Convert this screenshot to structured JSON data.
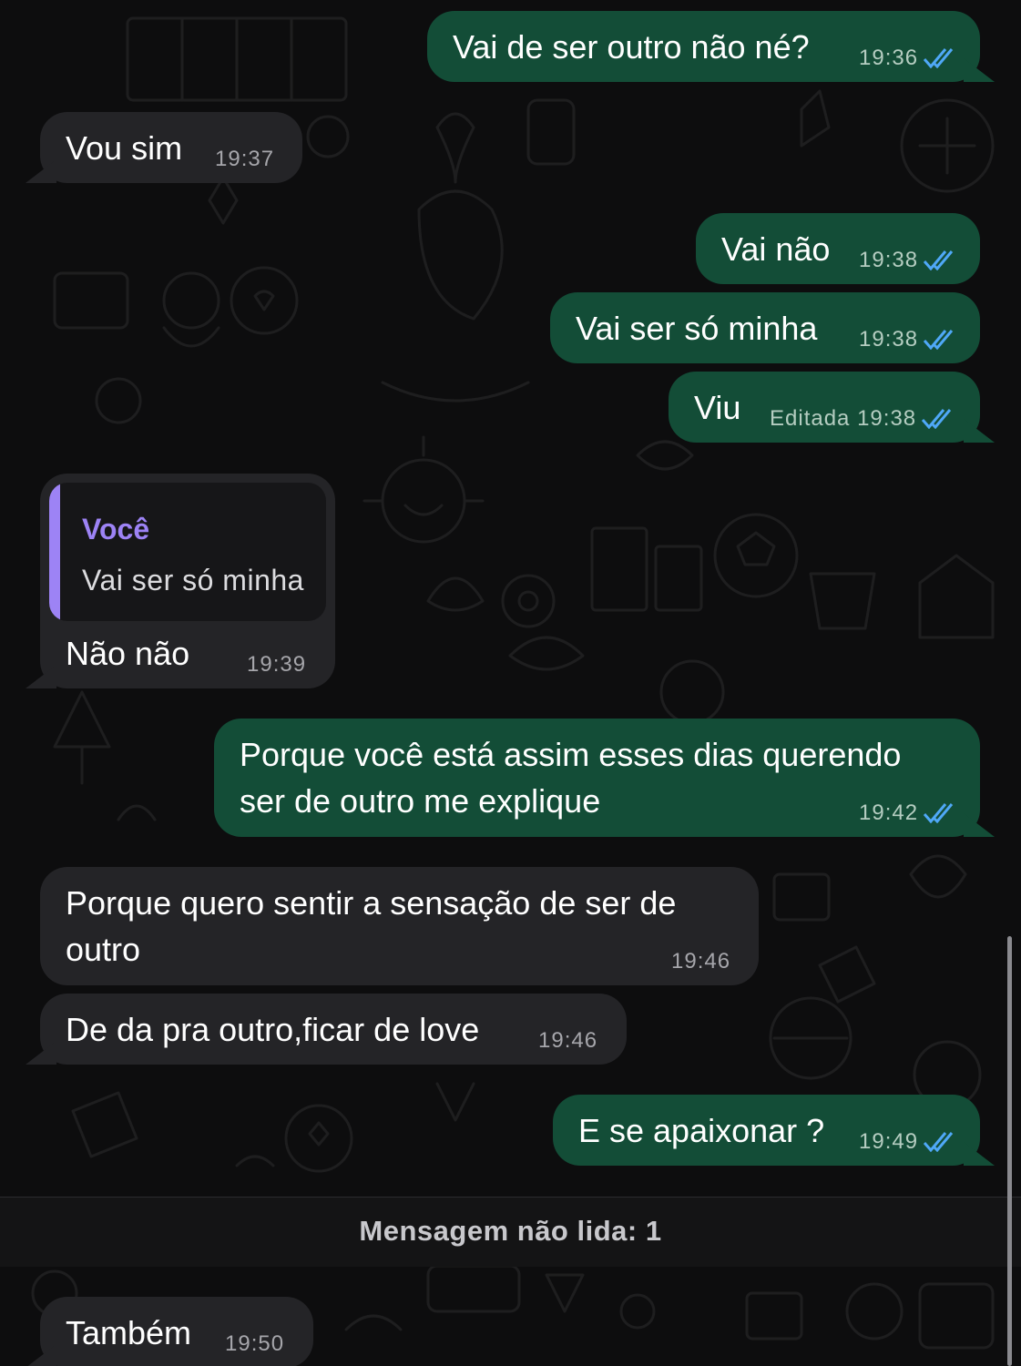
{
  "colors": {
    "outgoing_bubble": "#134d37",
    "incoming_bubble": "#242427",
    "read_ticks": "#4fa8f7",
    "quote_accent": "#9d83f5",
    "background": "#0d0d0e"
  },
  "messages": [
    {
      "direction": "out",
      "text": "Vai de ser outro não né?",
      "time": "19:36",
      "status": "read-double-check-icon"
    },
    {
      "direction": "in",
      "text": "Vou sim",
      "time": "19:37"
    },
    {
      "direction": "out",
      "text": "Vai não",
      "time": "19:38",
      "status": "read-double-check-icon"
    },
    {
      "direction": "out",
      "text": "Vai ser só minha",
      "time": "19:38",
      "status": "read-double-check-icon"
    },
    {
      "direction": "out",
      "text": "Viu",
      "edited_label": "Editada",
      "time": "19:38",
      "status": "read-double-check-icon"
    },
    {
      "direction": "in",
      "reply_to": {
        "author": "Você",
        "text": "Vai ser só minha"
      },
      "text": "Não não",
      "time": "19:39"
    },
    {
      "direction": "out",
      "lines": [
        "Porque você está assim esses dias querendo",
        "ser de outro me explique"
      ],
      "time": "19:42",
      "status": "read-double-check-icon"
    },
    {
      "direction": "in",
      "lines": [
        "Porque quero sentir a sensação de ser de",
        "outro"
      ],
      "time": "19:46"
    },
    {
      "direction": "in",
      "text": "De da pra outro,ficar de love",
      "time": "19:46"
    },
    {
      "direction": "out",
      "text": "E se apaixonar ?",
      "time": "19:49",
      "status": "read-double-check-icon"
    },
    {
      "direction": "in",
      "text": "Também",
      "time": "19:50"
    }
  ],
  "unread_divider": "Mensagem não lida: 1"
}
